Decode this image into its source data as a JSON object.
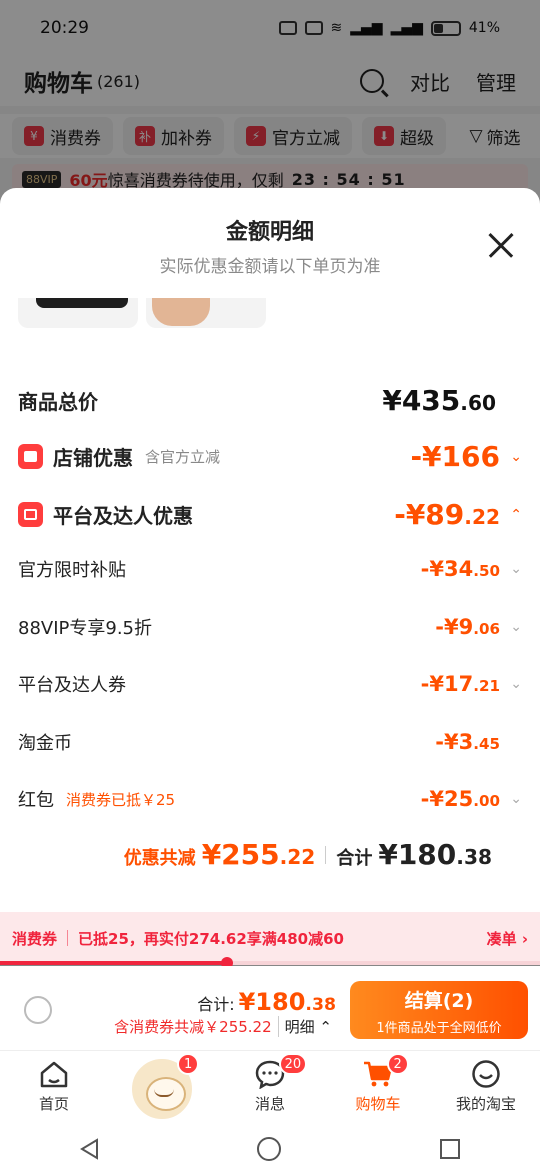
{
  "status_bar": {
    "time": "20:29",
    "battery": "41%"
  },
  "cart_header": {
    "title": "购物车",
    "count": "(261)",
    "compare": "对比",
    "manage": "管理"
  },
  "chips": [
    {
      "label": "消费券"
    },
    {
      "label": "加补券"
    },
    {
      "label": "官方立减"
    },
    {
      "label": "超级"
    }
  ],
  "filter_label": "筛选",
  "vip_bar": {
    "tag": "88VIP",
    "amount": "60元",
    "text": "惊喜消费券待使用，仅剩",
    "timer": "23 : 54 : 51"
  },
  "sheet": {
    "title": "金额明细",
    "subtitle": "实际优惠金额请以下单页为准",
    "goods_total": {
      "label": "商品总价",
      "int": "¥435",
      "dec": ".60"
    },
    "shop_discount": {
      "label": "店铺优惠",
      "note": "含官方立减",
      "int": "-¥166",
      "dec": ""
    },
    "platform_discount": {
      "label": "平台及达人优惠",
      "int": "-¥89",
      "dec": ".22"
    },
    "items": [
      {
        "label": "官方限时补贴",
        "note": "",
        "int": "-¥34",
        "dec": ".50",
        "chevron": true
      },
      {
        "label": "88VIP专享9.5折",
        "note": "",
        "int": "-¥9",
        "dec": ".06",
        "chevron": true
      },
      {
        "label": "平台及达人券",
        "note": "",
        "int": "-¥17",
        "dec": ".21",
        "chevron": true
      },
      {
        "label": "淘金币",
        "note": "",
        "int": "-¥3",
        "dec": ".45",
        "chevron": false
      },
      {
        "label": "红包",
        "note": "消费券已抵￥25",
        "int": "-¥25",
        "dec": ".00",
        "chevron": true
      }
    ],
    "summary": {
      "discount_label": "优惠共减",
      "discount_int": "¥255",
      "discount_dec": ".22",
      "total_label": "合计",
      "total_int": "¥180",
      "total_dec": ".38"
    }
  },
  "coupon_strip": {
    "tag": "消费券",
    "text": "已抵25，再实付274.62享满480减60",
    "action": "凑单 ›",
    "progress": 0.42
  },
  "checkout": {
    "total_label": "合计:",
    "total_int": "¥180",
    "total_dec": ".38",
    "save_text": "含消费券共减￥255.22",
    "detail": "明细 ⌃",
    "button_main": "结算(2)",
    "button_sub": "1件商品处于全网低价"
  },
  "tabs": [
    {
      "label": "首页",
      "badge": ""
    },
    {
      "label": "",
      "badge": "1"
    },
    {
      "label": "消息",
      "badge": "20"
    },
    {
      "label": "购物车",
      "badge": "2"
    },
    {
      "label": "我的淘宝",
      "badge": ""
    }
  ],
  "colors": {
    "accent": "#ff5000",
    "red": "#f0243d"
  }
}
